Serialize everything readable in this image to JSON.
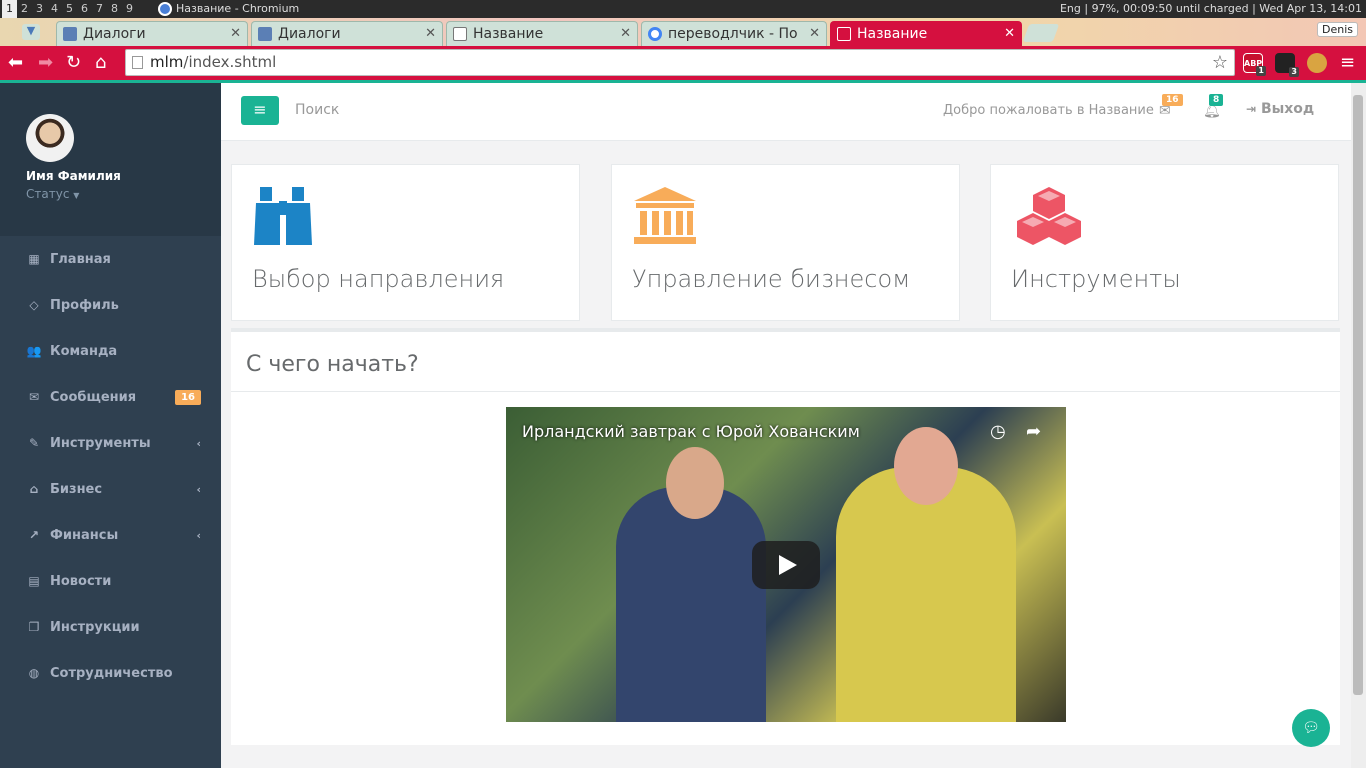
{
  "system": {
    "workspaces": [
      "1",
      "2",
      "3",
      "4",
      "5",
      "6",
      "7",
      "8",
      "9"
    ],
    "window_title": "Название - Chromium",
    "status_right": "Eng  | 97%, 00:09:50 until charged |  Wed Apr 13, 14:01"
  },
  "browser": {
    "tabs": [
      {
        "label": "Диалоги",
        "favicon_color": "#5b7fb5"
      },
      {
        "label": "Диалоги",
        "favicon_color": "#5b7fb5"
      },
      {
        "label": "Название",
        "favicon_color": "#888888"
      },
      {
        "label": "переводлчик - По",
        "favicon_color": "#4285f4"
      },
      {
        "label": "Название",
        "favicon_color": "#ffffff"
      }
    ],
    "profile": "Denis",
    "url_host": "mlm",
    "url_path": "/index.shtml",
    "extensions": [
      {
        "name": "ABP",
        "badge": "1"
      },
      {
        "name": "",
        "badge": "3"
      }
    ],
    "accent": "#d5103f"
  },
  "sidebar": {
    "user_name": "Имя Фамилия",
    "status": "Статус",
    "items": [
      {
        "label": "Главная",
        "icon": "grid-icon",
        "glyph": "▦"
      },
      {
        "label": "Профиль",
        "icon": "diamond-icon",
        "glyph": "◇"
      },
      {
        "label": "Команда",
        "icon": "users-icon",
        "glyph": "👥"
      },
      {
        "label": "Сообщения",
        "icon": "envelope-icon",
        "glyph": "✉",
        "badge": "16"
      },
      {
        "label": "Инструменты",
        "icon": "edit-icon",
        "glyph": "✎",
        "arrow": "‹"
      },
      {
        "label": "Бизнес",
        "icon": "bank-icon",
        "glyph": "⌂",
        "arrow": "‹"
      },
      {
        "label": "Финансы",
        "icon": "chart-icon",
        "glyph": "↗",
        "arrow": "‹"
      },
      {
        "label": "Новости",
        "icon": "newspaper-icon",
        "glyph": "▤"
      },
      {
        "label": "Инструкции",
        "icon": "copy-icon",
        "glyph": "❐"
      },
      {
        "label": "Сотрудничество",
        "icon": "globe-icon",
        "glyph": "◍"
      }
    ]
  },
  "topnav": {
    "search_placeholder": "Поиск",
    "welcome": "Добро пожаловать в Название",
    "mail_badge": "16",
    "bell_badge": "8",
    "logout": "Выход"
  },
  "cards": [
    {
      "title": "Выбор направления",
      "icon": "binoculars-icon",
      "color": "#1c84c6"
    },
    {
      "title": "Управление бизнесом",
      "icon": "bank-icon",
      "color": "#f8ac59"
    },
    {
      "title": "Инструменты",
      "icon": "cubes-icon",
      "color": "#ed5565"
    }
  ],
  "start": {
    "title": "С чего начать?",
    "video_title": "Ирландский завтрак с Юрой Хованским"
  }
}
